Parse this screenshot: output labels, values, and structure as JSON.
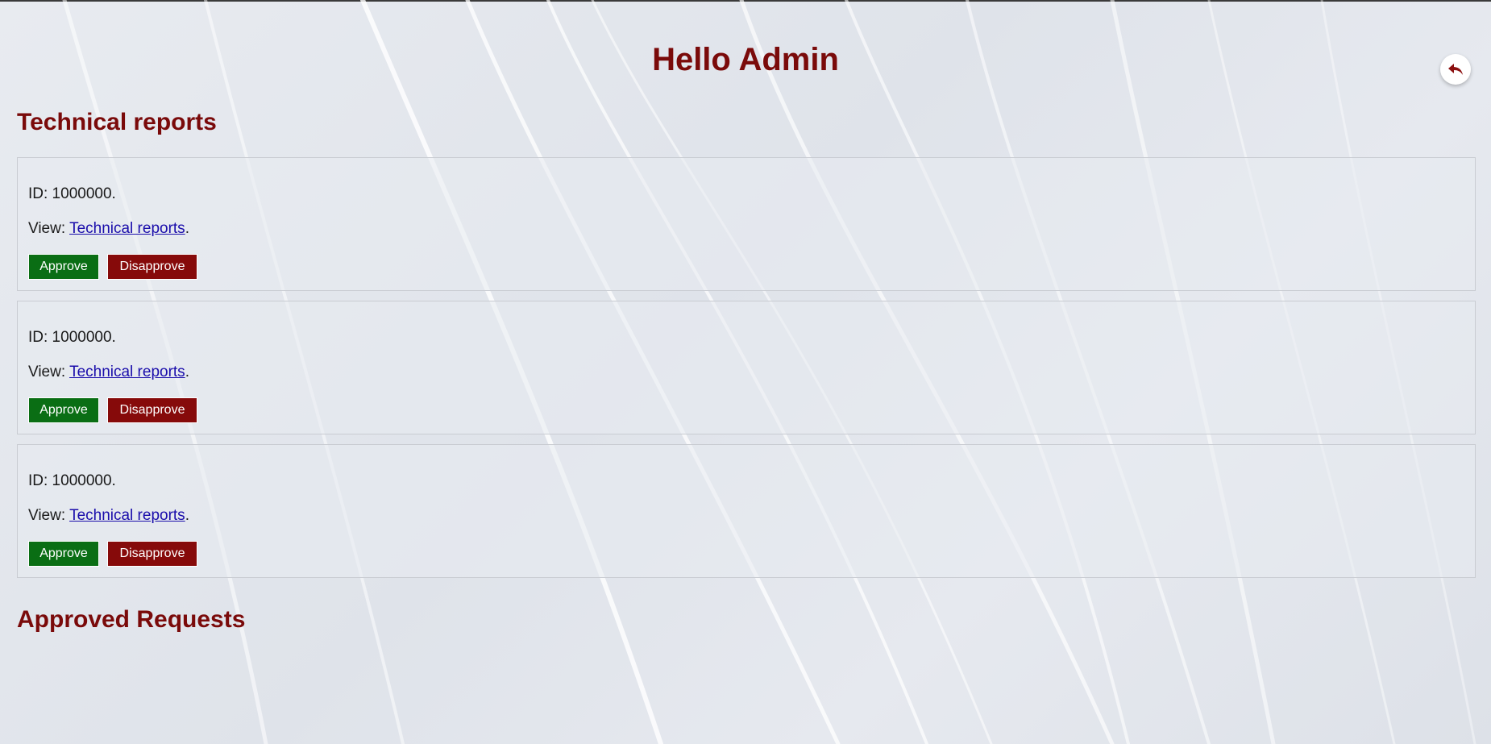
{
  "header": {
    "title": "Hello Admin",
    "back_icon": "reply-arrow-icon"
  },
  "technical_reports": {
    "heading": "Technical reports",
    "items": [
      {
        "id_label": "ID: 1000000.",
        "view_prefix": "View: ",
        "link_text": "Technical reports",
        "view_suffix": ".",
        "approve_label": "Approve",
        "disapprove_label": "Disapprove"
      },
      {
        "id_label": "ID: 1000000.",
        "view_prefix": "View: ",
        "link_text": "Technical reports",
        "view_suffix": ".",
        "approve_label": "Approve",
        "disapprove_label": "Disapprove"
      },
      {
        "id_label": "ID: 1000000.",
        "view_prefix": "View: ",
        "link_text": "Technical reports",
        "view_suffix": ".",
        "approve_label": "Approve",
        "disapprove_label": "Disapprove"
      }
    ]
  },
  "approved_requests": {
    "heading": "Approved Requests"
  },
  "colors": {
    "heading": "#7a0a0a",
    "approve": "#0a6e14",
    "disapprove": "#860a0a",
    "link": "#1a0dab",
    "background": "#e3e7ed"
  }
}
